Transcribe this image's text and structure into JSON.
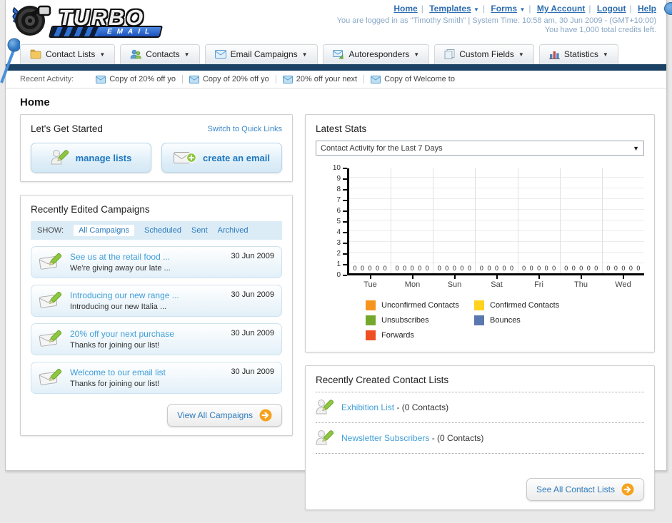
{
  "colors": {
    "navbar_blue": "#1b4264",
    "link_blue": "#2d7bbd",
    "light_link_blue": "#3f9fd8",
    "accent_orange": "#f6a21d"
  },
  "header": {
    "logo": {
      "title": "TURBO",
      "subtitle": "EMAIL"
    },
    "nav_links": [
      {
        "label": "Home",
        "dropdown": false
      },
      {
        "label": "Templates",
        "dropdown": true
      },
      {
        "label": "Forms",
        "dropdown": true
      },
      {
        "label": "My Account",
        "dropdown": false
      },
      {
        "label": "Logout",
        "dropdown": false
      },
      {
        "label": "Help",
        "dropdown": false
      }
    ],
    "login_info": "You are logged in as \"Timothy Smith\" | System Time: 10:58 am, 30 Jun 2009 - (GMT+10:00)",
    "credits_info": "You have 1,000 total credits left."
  },
  "tabs": [
    {
      "label": "Contact Lists",
      "icon": "folder-icon"
    },
    {
      "label": "Contacts",
      "icon": "contacts-icon"
    },
    {
      "label": "Email Campaigns",
      "icon": "envelope-icon"
    },
    {
      "label": "Autoresponders",
      "icon": "autoresponder-icon"
    },
    {
      "label": "Custom Fields",
      "icon": "custom-fields-icon"
    },
    {
      "label": "Statistics",
      "icon": "bar-chart-icon"
    }
  ],
  "recent_activity": {
    "label": "Recent Activity:",
    "items": [
      {
        "text": "Copy of 20% off yo",
        "icon": "envelope-icon"
      },
      {
        "text": "Copy of 20% off yo",
        "icon": "envelope-icon"
      },
      {
        "text": "20% off your next",
        "icon": "envelope-icon"
      },
      {
        "text": "Copy of Welcome to",
        "icon": "envelope-icon"
      }
    ]
  },
  "page_title": "Home",
  "get_started": {
    "title": "Let's Get Started",
    "switch_link": "Switch to Quick Links",
    "manage_button": "manage lists",
    "create_button": "create an email"
  },
  "campaigns": {
    "title": "Recently Edited Campaigns",
    "show_label": "SHOW:",
    "filters": [
      "All Campaigns",
      "Scheduled",
      "Sent",
      "Archived"
    ],
    "active_filter": "All Campaigns",
    "items": [
      {
        "title": "See us at the retail food ...",
        "subtitle": "We're giving away our late ...",
        "date": "30 Jun 2009"
      },
      {
        "title": "Introducing our new range ...",
        "subtitle": "Introducing our new Italia ...",
        "date": "30 Jun 2009"
      },
      {
        "title": "20% off your next purchase",
        "subtitle": "Thanks for joining our list!",
        "date": "30 Jun 2009"
      },
      {
        "title": "Welcome to our email list",
        "subtitle": "Thanks for joining our list!",
        "date": "30 Jun 2009"
      }
    ],
    "view_all_label": "View All Campaigns"
  },
  "stats": {
    "title": "Latest Stats",
    "dropdown_value": "Contact Activity for the Last 7 Days"
  },
  "chart_data": {
    "type": "bar",
    "title": "Contact Activity for the Last 7 Days",
    "categories": [
      "Tue",
      "Mon",
      "Sun",
      "Sat",
      "Fri",
      "Thu",
      "Wed"
    ],
    "series": [
      {
        "name": "Unconfirmed Contacts",
        "color": "#f7941e",
        "values": [
          0,
          0,
          0,
          0,
          0,
          0,
          0
        ]
      },
      {
        "name": "Confirmed Contacts",
        "color": "#ffd21e",
        "values": [
          0,
          0,
          0,
          0,
          0,
          0,
          0
        ]
      },
      {
        "name": "Unsubscribes",
        "color": "#74a82c",
        "values": [
          0,
          0,
          0,
          0,
          0,
          0,
          0
        ]
      },
      {
        "name": "Bounces",
        "color": "#5b77af",
        "values": [
          0,
          0,
          0,
          0,
          0,
          0,
          0
        ]
      },
      {
        "name": "Forwards",
        "color": "#ee4f23",
        "values": [
          0,
          0,
          0,
          0,
          0,
          0,
          0
        ]
      }
    ],
    "xlabel": "",
    "ylabel": "",
    "ylim": [
      0,
      10
    ],
    "yticks": [
      0,
      1,
      2,
      3,
      4,
      5,
      6,
      7,
      8,
      9,
      10
    ],
    "grid": true,
    "legend_position": "bottom"
  },
  "contact_lists": {
    "title": "Recently Created Contact Lists",
    "items": [
      {
        "name": "Exhibition List",
        "detail": "- (0 Contacts)"
      },
      {
        "name": "Newsletter Subscribers",
        "detail": "- (0 Contacts)"
      }
    ],
    "see_all_label": "See All Contact Lists"
  }
}
